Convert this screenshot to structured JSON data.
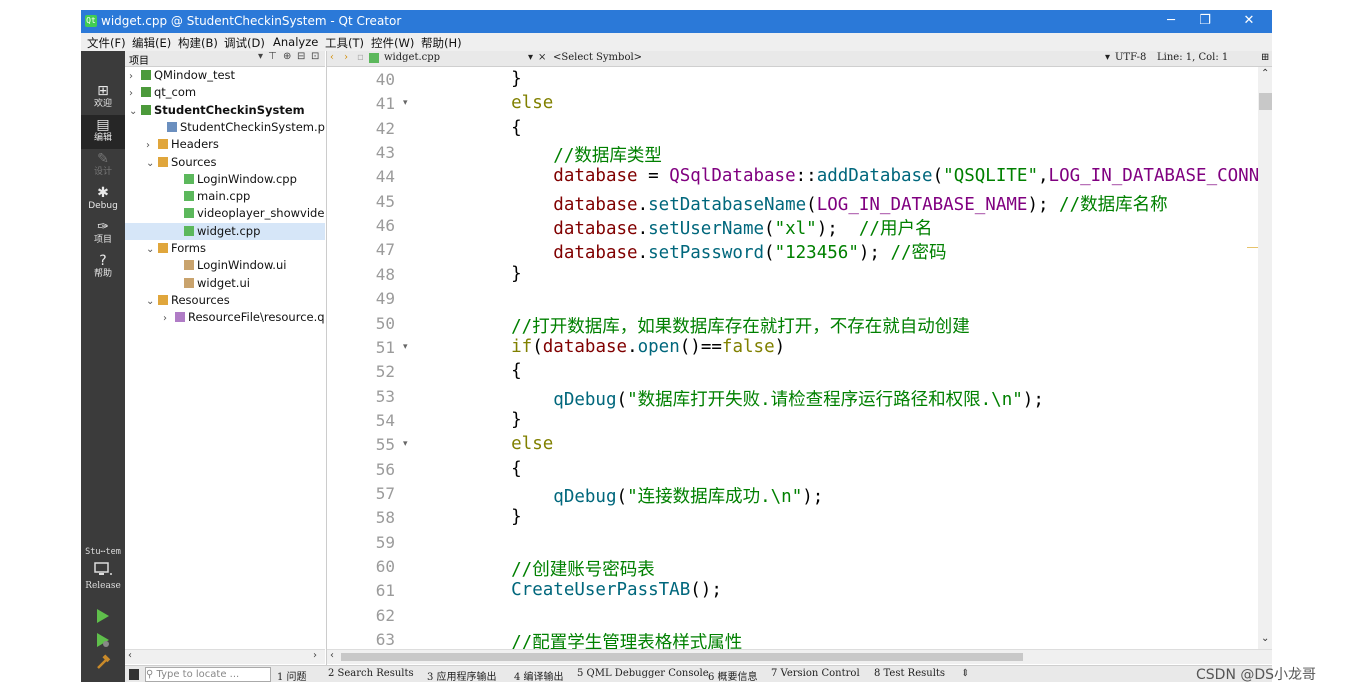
{
  "window": {
    "title": "widget.cpp @ StudentCheckinSystem - Qt Creator",
    "minimize": "─",
    "maximize": "❐",
    "close": "✕"
  },
  "menu": [
    "文件(F)",
    "编辑(E)",
    "构建(B)",
    "调试(D)",
    "Analyze",
    "工具(T)",
    "控件(W)",
    "帮助(H)"
  ],
  "modes": [
    {
      "icon": "grid-icon",
      "glyph": "⊞",
      "label": "欢迎"
    },
    {
      "icon": "edit-icon",
      "glyph": "▤",
      "label": "编辑"
    },
    {
      "icon": "design-icon",
      "glyph": "✎",
      "label": "设计"
    },
    {
      "icon": "bug-icon",
      "glyph": "✱",
      "label": "Debug"
    },
    {
      "icon": "wrench-icon",
      "glyph": "✑",
      "label": "项目"
    },
    {
      "icon": "help-icon",
      "glyph": "?",
      "label": "帮助"
    }
  ],
  "kit": {
    "name": "Stu⋯tem",
    "build": "Release"
  },
  "project_panel": {
    "header": "项目",
    "tree": [
      {
        "label": "QMindow_test",
        "arrow": "›",
        "type": "project"
      },
      {
        "label": "qt_com",
        "arrow": "›",
        "type": "project"
      },
      {
        "label": "StudentCheckinSystem",
        "arrow": "⌄",
        "type": "project"
      },
      {
        "label": "StudentCheckinSystem.pro",
        "arrow": "",
        "type": "pro"
      },
      {
        "label": "Headers",
        "arrow": "›",
        "type": "folder"
      },
      {
        "label": "Sources",
        "arrow": "⌄",
        "type": "folder"
      },
      {
        "label": "LoginWindow.cpp",
        "arrow": "",
        "type": "cpp"
      },
      {
        "label": "main.cpp",
        "arrow": "",
        "type": "cpp"
      },
      {
        "label": "videoplayer_showvideow",
        "arrow": "",
        "type": "cpp"
      },
      {
        "label": "widget.cpp",
        "arrow": "",
        "type": "cpp"
      },
      {
        "label": "Forms",
        "arrow": "⌄",
        "type": "folder"
      },
      {
        "label": "LoginWindow.ui",
        "arrow": "",
        "type": "ui"
      },
      {
        "label": "widget.ui",
        "arrow": "",
        "type": "ui"
      },
      {
        "label": "Resources",
        "arrow": "⌄",
        "type": "folder"
      },
      {
        "label": "ResourceFile\\resource.qrc",
        "arrow": "›",
        "type": "qrc"
      }
    ]
  },
  "editor": {
    "file": "widget.cpp",
    "symbol": "<Select Symbol>",
    "encoding": "UTF-8",
    "position": "Line: 1, Col: 1",
    "lines": [
      {
        "n": "40",
        "fold": "",
        "parts": [
          [
            "p",
            "    }"
          ]
        ]
      },
      {
        "n": "41",
        "fold": "▾",
        "parts": [
          [
            "kw",
            "    else"
          ]
        ]
      },
      {
        "n": "42",
        "fold": "",
        "parts": [
          [
            "p",
            "    {"
          ]
        ]
      },
      {
        "n": "43",
        "fold": "",
        "parts": [
          [
            "cm",
            "        //数据库类型"
          ]
        ]
      },
      {
        "n": "44",
        "fold": "",
        "parts": [
          [
            "var",
            "        database"
          ],
          [
            "p",
            " = "
          ],
          [
            "cls",
            "QSqlDatabase"
          ],
          [
            "p",
            "::"
          ],
          [
            "fn",
            "addDatabase"
          ],
          [
            "p",
            "("
          ],
          [
            "str",
            "\"QSQLITE\""
          ],
          [
            "p",
            ","
          ],
          [
            "cls",
            "LOG_IN_DATABASE_CONN"
          ]
        ]
      },
      {
        "n": "45",
        "fold": "",
        "parts": [
          [
            "var",
            "        database"
          ],
          [
            "p",
            "."
          ],
          [
            "fn",
            "setDatabaseName"
          ],
          [
            "p",
            "("
          ],
          [
            "cls",
            "LOG_IN_DATABASE_NAME"
          ],
          [
            "p",
            "); "
          ],
          [
            "cm",
            "//数据库名称"
          ]
        ]
      },
      {
        "n": "46",
        "fold": "",
        "parts": [
          [
            "var",
            "        database"
          ],
          [
            "p",
            "."
          ],
          [
            "fn",
            "setUserName"
          ],
          [
            "p",
            "("
          ],
          [
            "str",
            "\"xl\""
          ],
          [
            "p",
            ");  "
          ],
          [
            "cm",
            "//用户名"
          ]
        ]
      },
      {
        "n": "47",
        "fold": "",
        "parts": [
          [
            "var",
            "        database"
          ],
          [
            "p",
            "."
          ],
          [
            "fn",
            "setPassword"
          ],
          [
            "p",
            "("
          ],
          [
            "str",
            "\"123456\""
          ],
          [
            "p",
            "); "
          ],
          [
            "cm",
            "//密码"
          ]
        ]
      },
      {
        "n": "48",
        "fold": "",
        "parts": [
          [
            "p",
            "    }"
          ]
        ]
      },
      {
        "n": "49",
        "fold": "",
        "parts": [
          [
            "p",
            ""
          ]
        ]
      },
      {
        "n": "50",
        "fold": "",
        "parts": [
          [
            "cm",
            "    //打开数据库，如果数据库存在就打开，不存在就自动创建"
          ]
        ]
      },
      {
        "n": "51",
        "fold": "▾",
        "parts": [
          [
            "kw",
            "    if"
          ],
          [
            "p",
            "("
          ],
          [
            "var",
            "database"
          ],
          [
            "p",
            "."
          ],
          [
            "fn",
            "open"
          ],
          [
            "p",
            "()=="
          ],
          [
            "kw",
            "false"
          ],
          [
            "p",
            ")"
          ]
        ]
      },
      {
        "n": "52",
        "fold": "",
        "parts": [
          [
            "p",
            "    {"
          ]
        ]
      },
      {
        "n": "53",
        "fold": "",
        "parts": [
          [
            "fn",
            "        qDebug"
          ],
          [
            "p",
            "("
          ],
          [
            "str",
            "\"数据库打开失败.请检查程序运行路径和权限.\\n\""
          ],
          [
            "p",
            ");"
          ]
        ]
      },
      {
        "n": "54",
        "fold": "",
        "parts": [
          [
            "p",
            "    }"
          ]
        ]
      },
      {
        "n": "55",
        "fold": "▾",
        "parts": [
          [
            "kw",
            "    else"
          ]
        ]
      },
      {
        "n": "56",
        "fold": "",
        "parts": [
          [
            "p",
            "    {"
          ]
        ]
      },
      {
        "n": "57",
        "fold": "",
        "parts": [
          [
            "fn",
            "        qDebug"
          ],
          [
            "p",
            "("
          ],
          [
            "str",
            "\"连接数据库成功.\\n\""
          ],
          [
            "p",
            ");"
          ]
        ]
      },
      {
        "n": "58",
        "fold": "",
        "parts": [
          [
            "p",
            "    }"
          ]
        ]
      },
      {
        "n": "59",
        "fold": "",
        "parts": [
          [
            "p",
            ""
          ]
        ]
      },
      {
        "n": "60",
        "fold": "",
        "parts": [
          [
            "cm",
            "    //创建账号密码表"
          ]
        ]
      },
      {
        "n": "61",
        "fold": "",
        "parts": [
          [
            "fn",
            "    CreateUserPassTAB"
          ],
          [
            "p",
            "();"
          ]
        ]
      },
      {
        "n": "62",
        "fold": "",
        "parts": [
          [
            "p",
            ""
          ]
        ]
      },
      {
        "n": "63",
        "fold": "",
        "parts": [
          [
            "cm",
            "    //配置学生管理表格样式属性"
          ]
        ]
      }
    ]
  },
  "statusbar": {
    "locator_placeholder": "Type to locate ...",
    "items": [
      "1 问题",
      "2 Search Results",
      "3 应用程序输出",
      "4 编译输出",
      "5 QML Debugger Console",
      "6 概要信息",
      "7 Version Control",
      "8 Test Results",
      "⇕"
    ]
  },
  "watermark": "CSDN @DS小龙哥"
}
